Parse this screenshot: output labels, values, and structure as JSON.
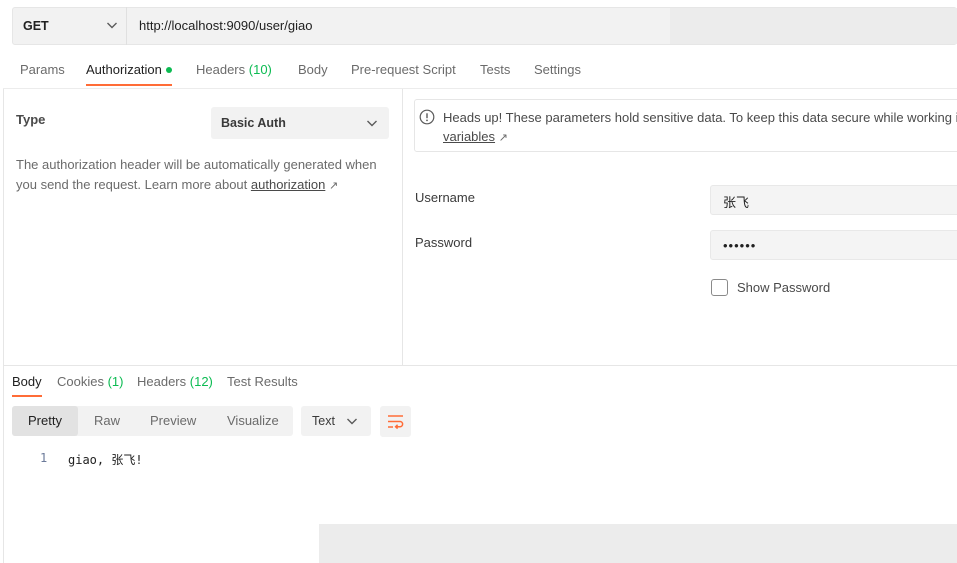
{
  "request": {
    "method": "GET",
    "url": "http://localhost:9090/user/giao"
  },
  "request_tabs": [
    {
      "label": "Params",
      "active": false
    },
    {
      "label": "Authorization",
      "active": true,
      "dot": true
    },
    {
      "label": "Headers",
      "count": "(10)",
      "active": false
    },
    {
      "label": "Body",
      "active": false
    },
    {
      "label": "Pre-request Script",
      "active": false
    },
    {
      "label": "Tests",
      "active": false
    },
    {
      "label": "Settings",
      "active": false
    }
  ],
  "auth": {
    "type_label": "Type",
    "type_value": "Basic Auth",
    "description": "The authorization header will be automatically generated when you send the request. Learn more about",
    "description_link": "authorization",
    "link_arrow": "↗"
  },
  "notice": {
    "text": "Heads up! These parameters hold sensitive data. To keep this data secure while working in",
    "link": "variables",
    "link_arrow": "↗"
  },
  "fields": {
    "username_label": "Username",
    "username_value": "张飞",
    "password_label": "Password",
    "password_value": "••••••",
    "show_password_label": "Show Password"
  },
  "response_tabs": [
    {
      "label": "Body",
      "active": true
    },
    {
      "label": "Cookies",
      "count": "(1)",
      "active": false
    },
    {
      "label": "Headers",
      "count": "(12)",
      "active": false
    },
    {
      "label": "Test Results",
      "active": false
    }
  ],
  "view_modes": [
    {
      "label": "Pretty",
      "active": true
    },
    {
      "label": "Raw",
      "active": false
    },
    {
      "label": "Preview",
      "active": false
    },
    {
      "label": "Visualize",
      "active": false
    }
  ],
  "format": "Text",
  "response_body": {
    "line_number": "1",
    "content": "giao, 张飞!"
  },
  "colors": {
    "accent": "#ff6c37",
    "green": "#0cbb52"
  }
}
